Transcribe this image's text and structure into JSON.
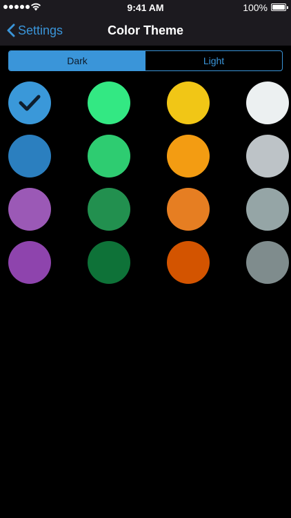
{
  "status_bar": {
    "time": "9:41 AM",
    "battery_percent": "100%",
    "signal_bars": 5,
    "signal-icon": "signal-dots-icon",
    "wifi_icon": "wifi-icon",
    "battery_icon": "battery-icon"
  },
  "nav": {
    "back_label": "Settings",
    "back_icon": "chevron-left-icon",
    "title": "Color Theme"
  },
  "theme_toggle": {
    "segments": [
      {
        "label": "Dark",
        "selected": true
      },
      {
        "label": "Light",
        "selected": false
      }
    ]
  },
  "colors": {
    "accent": "#3a95d9",
    "nav_background": "#1c1a1f",
    "background": "#000000"
  },
  "swatches": [
    {
      "color": "#3a98d9",
      "selected": true
    },
    {
      "color": "#33e883",
      "selected": false
    },
    {
      "color": "#f1c616",
      "selected": false
    },
    {
      "color": "#ecf0f1",
      "selected": false
    },
    {
      "color": "#2b7fbf",
      "selected": false
    },
    {
      "color": "#2ecc71",
      "selected": false
    },
    {
      "color": "#f39c12",
      "selected": false
    },
    {
      "color": "#bdc3c7",
      "selected": false
    },
    {
      "color": "#9b59b6",
      "selected": false
    },
    {
      "color": "#22904f",
      "selected": false
    },
    {
      "color": "#e67e22",
      "selected": false
    },
    {
      "color": "#95a5a6",
      "selected": false
    },
    {
      "color": "#8e44ad",
      "selected": false
    },
    {
      "color": "#0e7238",
      "selected": false
    },
    {
      "color": "#d35400",
      "selected": false
    },
    {
      "color": "#7f8c8d",
      "selected": false
    }
  ],
  "checkmark_icon": "checkmark-icon"
}
